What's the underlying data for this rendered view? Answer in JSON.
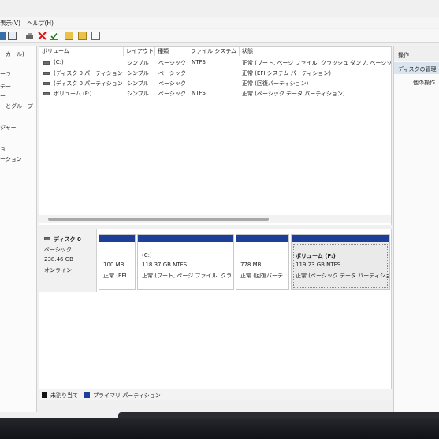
{
  "menubar": {
    "items": [
      "表示(V)",
      "ヘルプ(H)"
    ]
  },
  "nav": {
    "items": [
      "ーカール)",
      "ーラ",
      "テー",
      "ー",
      "ーとグループ",
      "ジャー",
      "ョ",
      "ーション"
    ]
  },
  "volume_list": {
    "columns": [
      "ボリューム",
      "レイアウト",
      "種類",
      "ファイル システム",
      "状態"
    ],
    "rows": [
      {
        "name": "(C:)",
        "layout": "シンプル",
        "type": "ベーシック",
        "fs": "NTFS",
        "status": "正常 (ブート, ページ ファイル, クラッシュ ダンプ, ベーシック デ"
      },
      {
        "name": "(ディスク 0 パーティション 1)",
        "layout": "シンプル",
        "type": "ベーシック",
        "fs": "",
        "status": "正常 (EFI システム パーティション)"
      },
      {
        "name": "(ディスク 0 パーティション 4)",
        "layout": "シンプル",
        "type": "ベーシック",
        "fs": "",
        "status": "正常 (回復パーティション)"
      },
      {
        "name": "ボリューム (F:)",
        "layout": "シンプル",
        "type": "ベーシック",
        "fs": "NTFS",
        "status": "正常 (ベーシック データ パーティション)"
      }
    ]
  },
  "disk": {
    "title": "ディスク 0",
    "type": "ベーシック",
    "size": "238.46 GB",
    "status": "オンライン",
    "partitions": [
      {
        "name": "",
        "size": "100 MB",
        "status": "正常 (EFI"
      },
      {
        "name": "(C:)",
        "size": "118.37 GB NTFS",
        "status": "正常 (ブート, ページ ファイル, クラッ"
      },
      {
        "name": "",
        "size": "778 MB",
        "status": "正常 (回復パーテ"
      },
      {
        "name": "ボリューム (F:)",
        "size": "119.23 GB NTFS",
        "status": "正常 (ベーシック データ パーティショ"
      }
    ]
  },
  "legend": {
    "unallocated": "未割り当て",
    "primary": "プライマリ パーティション"
  },
  "actions": {
    "header": "操作",
    "selected": "ディスクの管理",
    "other": "他の操作"
  },
  "colors": {
    "primary_partition": "#1e3f99",
    "unallocated": "#111111"
  }
}
